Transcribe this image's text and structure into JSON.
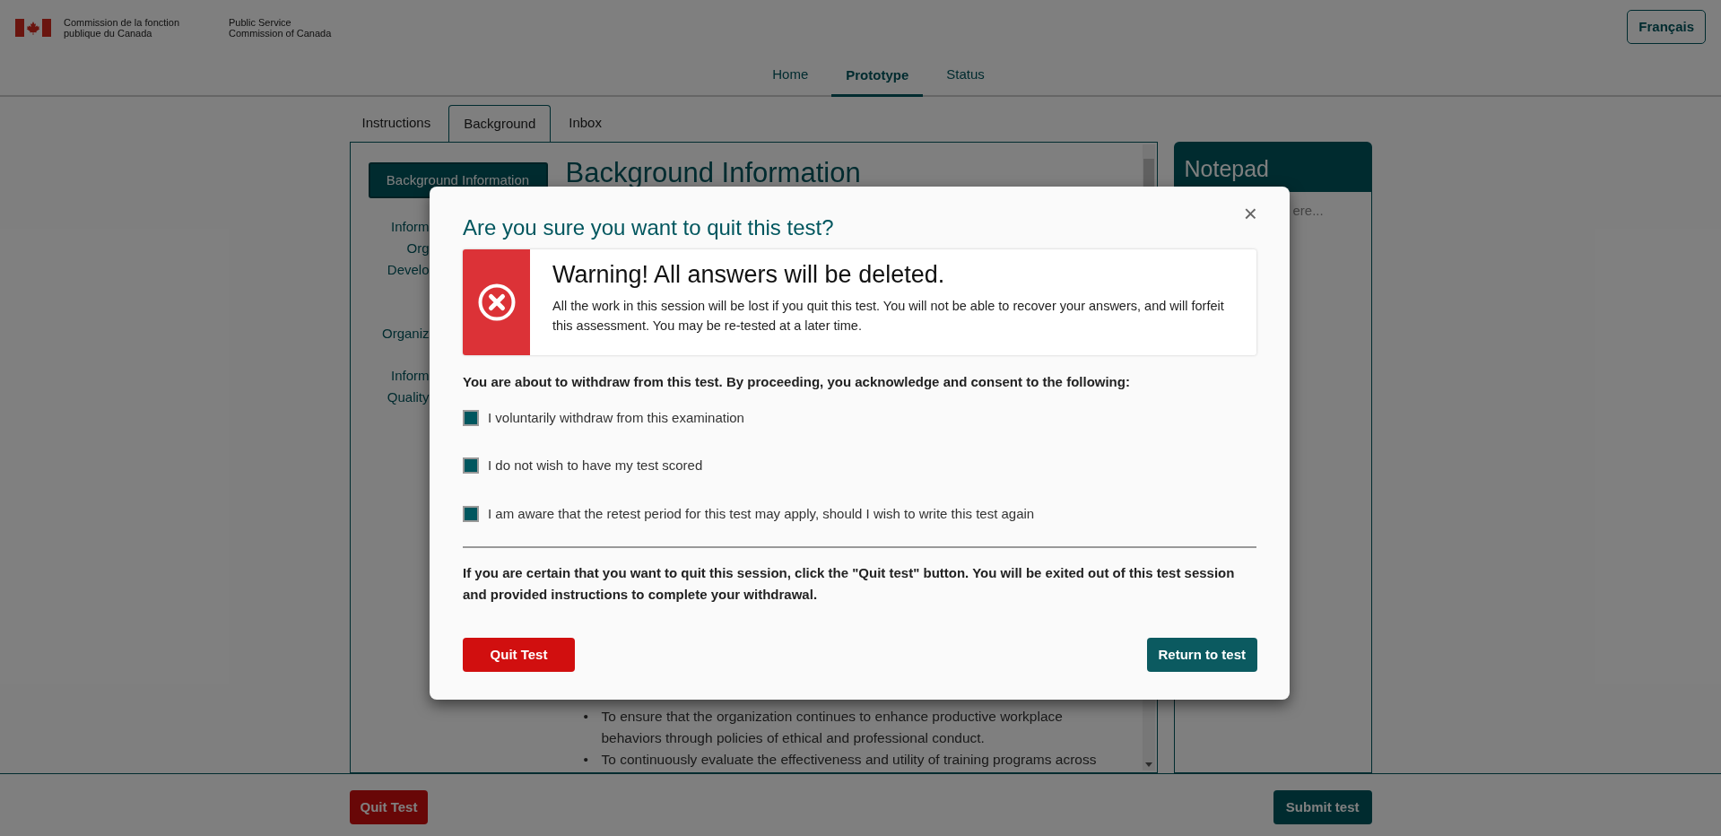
{
  "header": {
    "org_fr": "Commission de la fonction publique du Canada",
    "org_en": "Public Service Commission of Canada",
    "language_button": "Français"
  },
  "nav": [
    {
      "label": "Home",
      "selected": false
    },
    {
      "label": "Prototype",
      "selected": true
    },
    {
      "label": "Status",
      "selected": false
    }
  ],
  "tabs": [
    {
      "label": "Instructions",
      "selected": false
    },
    {
      "label": "Background",
      "selected": true
    },
    {
      "label": "Inbox",
      "selected": false
    }
  ],
  "sidebar": {
    "button": "Background Information",
    "groups": [
      [
        "Inform",
        "Org",
        "Develo"
      ],
      [
        "Organiz"
      ],
      [
        "Inform",
        "Quality"
      ]
    ]
  },
  "content": {
    "heading": "Background Information",
    "bullets": [
      {
        "marker": "•",
        "text": "To ensure that the organization continues to enhance productive workplace behaviors through policies of ethical and professional conduct."
      },
      {
        "marker": "•",
        "text": "To continuously evaluate the effectiveness and utility of training programs across"
      }
    ]
  },
  "notepad": {
    "title": "Notepad",
    "placeholder": "ere..."
  },
  "footer": {
    "quit_button": "Quit Test",
    "submit_button": "Submit test"
  },
  "modal": {
    "title": "Are you sure you want to quit this test?",
    "close": "×",
    "warning": {
      "title": "Warning! All answers will be deleted.",
      "text": "All the work in this session will be lost if you quit this test. You will not be able to recover your answers, and will forfeit this assessment. You may be re-tested at a later time."
    },
    "intro": "You are about to withdraw from this test. By proceeding, you acknowledge and consent to the following:",
    "checks": [
      {
        "label": "I voluntarily withdraw from this examination",
        "checked": true
      },
      {
        "label": "I do not wish to have my test scored",
        "checked": true
      },
      {
        "label": "I am aware that the retest period for this test may apply, should I wish to write this test again",
        "checked": true
      }
    ],
    "note": "If you are certain that you want to quit this session, click the \"Quit test\" button. You will be exited out of this test session and provided instructions to complete your withdrawal.",
    "quit_button": "Quit Test",
    "return_button": "Return to test"
  }
}
